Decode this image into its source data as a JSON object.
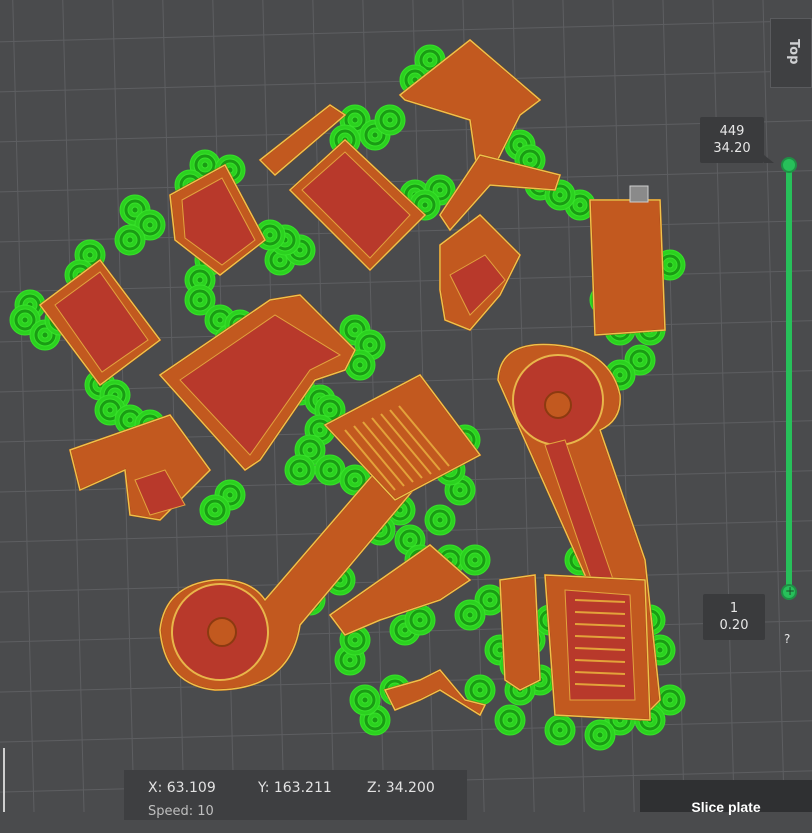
{
  "view_cube": {
    "label": "Top"
  },
  "layer_slider": {
    "top": {
      "layer": "449",
      "height": "34.20"
    },
    "bottom": {
      "layer": "1",
      "height": "0.20"
    },
    "help": "?"
  },
  "coordinates": {
    "x": "X: 63.109",
    "y": "Y: 163.211",
    "z": "Z: 34.200",
    "speed": "Speed: 10"
  },
  "slice_button": {
    "label": "Slice plate"
  },
  "colors": {
    "grid": "#5b5c5f",
    "background": "#4a4b4d",
    "wall": "#c2591f",
    "infill": "#b8392b",
    "support": "#26c41d",
    "slider": "#27c05a"
  }
}
